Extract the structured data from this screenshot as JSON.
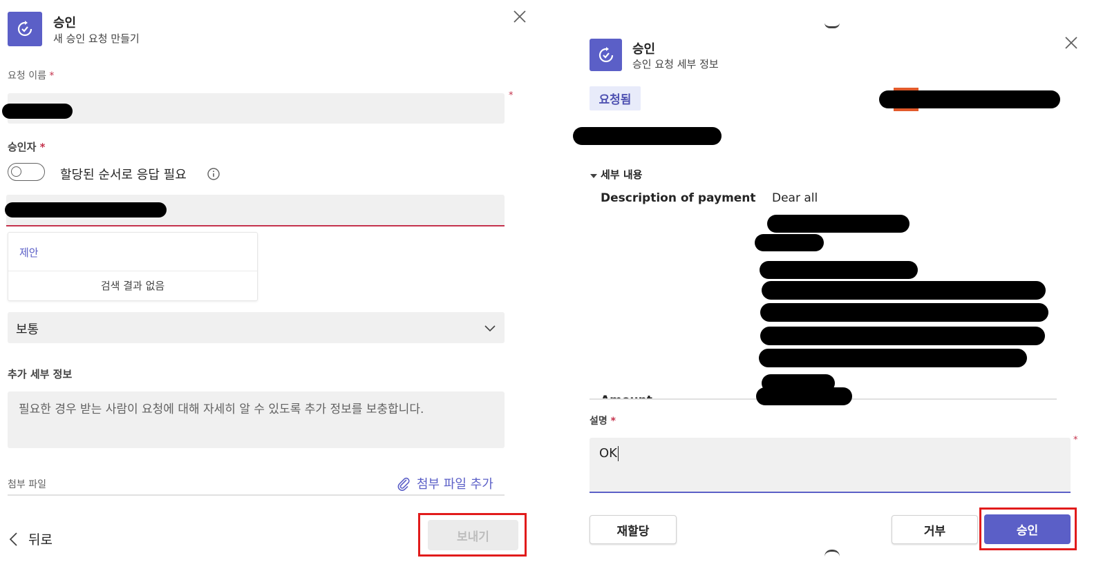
{
  "left": {
    "app_title": "승인",
    "app_subtitle": "새 승인 요청 만들기",
    "request_name_label": "요청 이름",
    "approvers_label": "승인자",
    "toggle_label": "할당된 순서로 응답 필요",
    "suggestions_header": "제안",
    "suggestions_empty": "검색 결과 없음",
    "priority_value": "보통",
    "details_label": "추가 세부 정보",
    "details_placeholder": "필요한 경우 받는 사람이 요청에 대해 자세히 알 수 있도록 추가 정보를 보충합니다.",
    "attachments_label": "첨부 파일",
    "add_attachment_label": "첨부 파일 추가",
    "back_label": "뒤로",
    "send_label": "보내기"
  },
  "right": {
    "app_title": "승인",
    "app_subtitle": "승인 요청 세부 정보",
    "status_badge": "요청됨",
    "details_section": "세부 내용",
    "description_key": "Description of payment",
    "description_value": "Dear all",
    "amount_key_partial": "Amount",
    "comment_label": "설명",
    "comment_value": "OK",
    "reassign_label": "재할당",
    "reject_label": "거부",
    "approve_label": "승인"
  },
  "colors": {
    "accent": "#5b5fc7",
    "required": "#c4314b",
    "highlight": "#e11b1b",
    "status_badge_bg": "#e8ebfa"
  }
}
